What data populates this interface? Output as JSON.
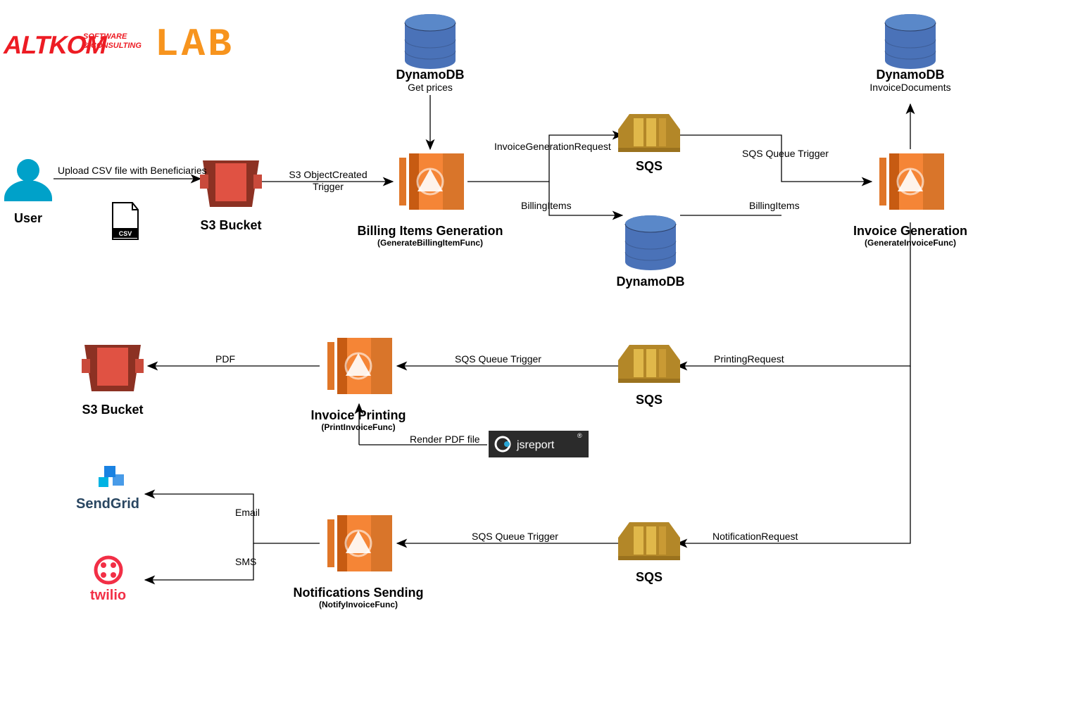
{
  "nodes": {
    "user": {
      "title": "User"
    },
    "csv": {
      "label": "CSV"
    },
    "s3_upload": {
      "title": "S3 Bucket"
    },
    "dynamo_prices": {
      "title": "DynamoDB",
      "sub": "Get prices"
    },
    "billing": {
      "title": "Billing Items Generation",
      "sub": "(GenerateBillingItemFunc)"
    },
    "sqs_invoice_req": {
      "title": "SQS"
    },
    "dynamo_billing": {
      "title": "DynamoDB"
    },
    "invoice_gen": {
      "title": "Invoice Generation",
      "sub": "(GenerateInvoiceFunc)"
    },
    "dynamo_invoice_docs": {
      "title": "DynamoDB",
      "sub": "InvoiceDocuments"
    },
    "sqs_printing": {
      "title": "SQS"
    },
    "invoice_print": {
      "title": "Invoice Printing",
      "sub": "(PrintInvoiceFunc)"
    },
    "s3_pdf": {
      "title": "S3 Bucket"
    },
    "jsreport": {
      "label": "jsreport"
    },
    "sqs_notify": {
      "title": "SQS"
    },
    "notify": {
      "title": "Notifications Sending",
      "sub": "(NotifyInvoiceFunc)"
    },
    "sendgrid": {
      "label": "SendGrid"
    },
    "twilio": {
      "label": "twilio"
    }
  },
  "edges": {
    "upload_csv": "Upload CSV file with Beneficiaries",
    "s3_trigger": "S3 ObjectCreated\nTrigger",
    "invoice_req": "InvoiceGenerationRequest",
    "billing_items_down": "BillingItems",
    "sqs_trigger_1": "SQS Queue Trigger",
    "billing_items_right": "BillingItems",
    "printing_req": "PrintingRequest",
    "sqs_trigger_2": "SQS Queue Trigger",
    "pdf": "PDF",
    "render_pdf": "Render PDF file",
    "notification_req": "NotificationRequest",
    "sqs_trigger_3": "SQS Queue Trigger",
    "email": "Email",
    "sms": "SMS"
  },
  "logos": {
    "altkom": "ALTKOM",
    "altkom_tag": "SOFTWARE\n& CONSULTING",
    "lab": "LAB"
  }
}
